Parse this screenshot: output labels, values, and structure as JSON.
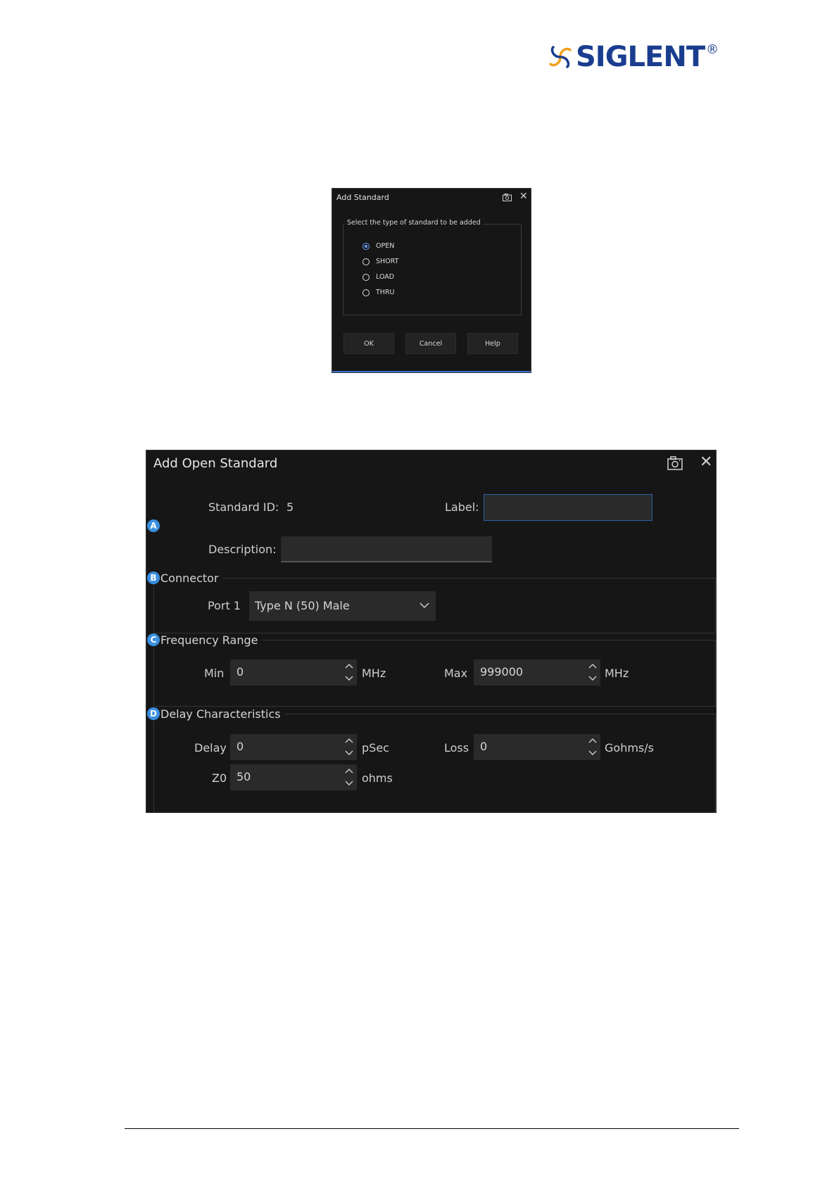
{
  "logo": {
    "text": "SIGLENT",
    "reg": "®"
  },
  "add_standard": {
    "title": "Add Standard",
    "group_label": "Select the type of standard to be added",
    "options": [
      "OPEN",
      "SHORT",
      "LOAD",
      "THRU"
    ],
    "selected": "OPEN",
    "buttons": {
      "ok": "OK",
      "cancel": "Cancel",
      "help": "Help"
    }
  },
  "add_open_standard": {
    "title": "Add Open Standard",
    "badges": {
      "a": "A",
      "b": "B",
      "c": "C",
      "d": "D"
    },
    "standard_id_label": "Standard ID:",
    "standard_id_value": "5",
    "label_label": "Label:",
    "label_value": "",
    "description_label": "Description:",
    "description_value": "",
    "connector": {
      "legend": "Connector",
      "port_label": "Port 1",
      "port_value": "Type N (50) Male"
    },
    "frequency_range": {
      "legend": "Frequency Range",
      "min_label": "Min",
      "min_value": "0",
      "min_unit": "MHz",
      "max_label": "Max",
      "max_value": "999000",
      "max_unit": "MHz"
    },
    "delay": {
      "legend": "Delay Characteristics",
      "delay_label": "Delay",
      "delay_value": "0",
      "delay_unit": "pSec",
      "loss_label": "Loss",
      "loss_value": "0",
      "loss_unit": "Gohms/s",
      "z0_label": "Z0",
      "z0_value": "50",
      "z0_unit": "ohms"
    }
  }
}
